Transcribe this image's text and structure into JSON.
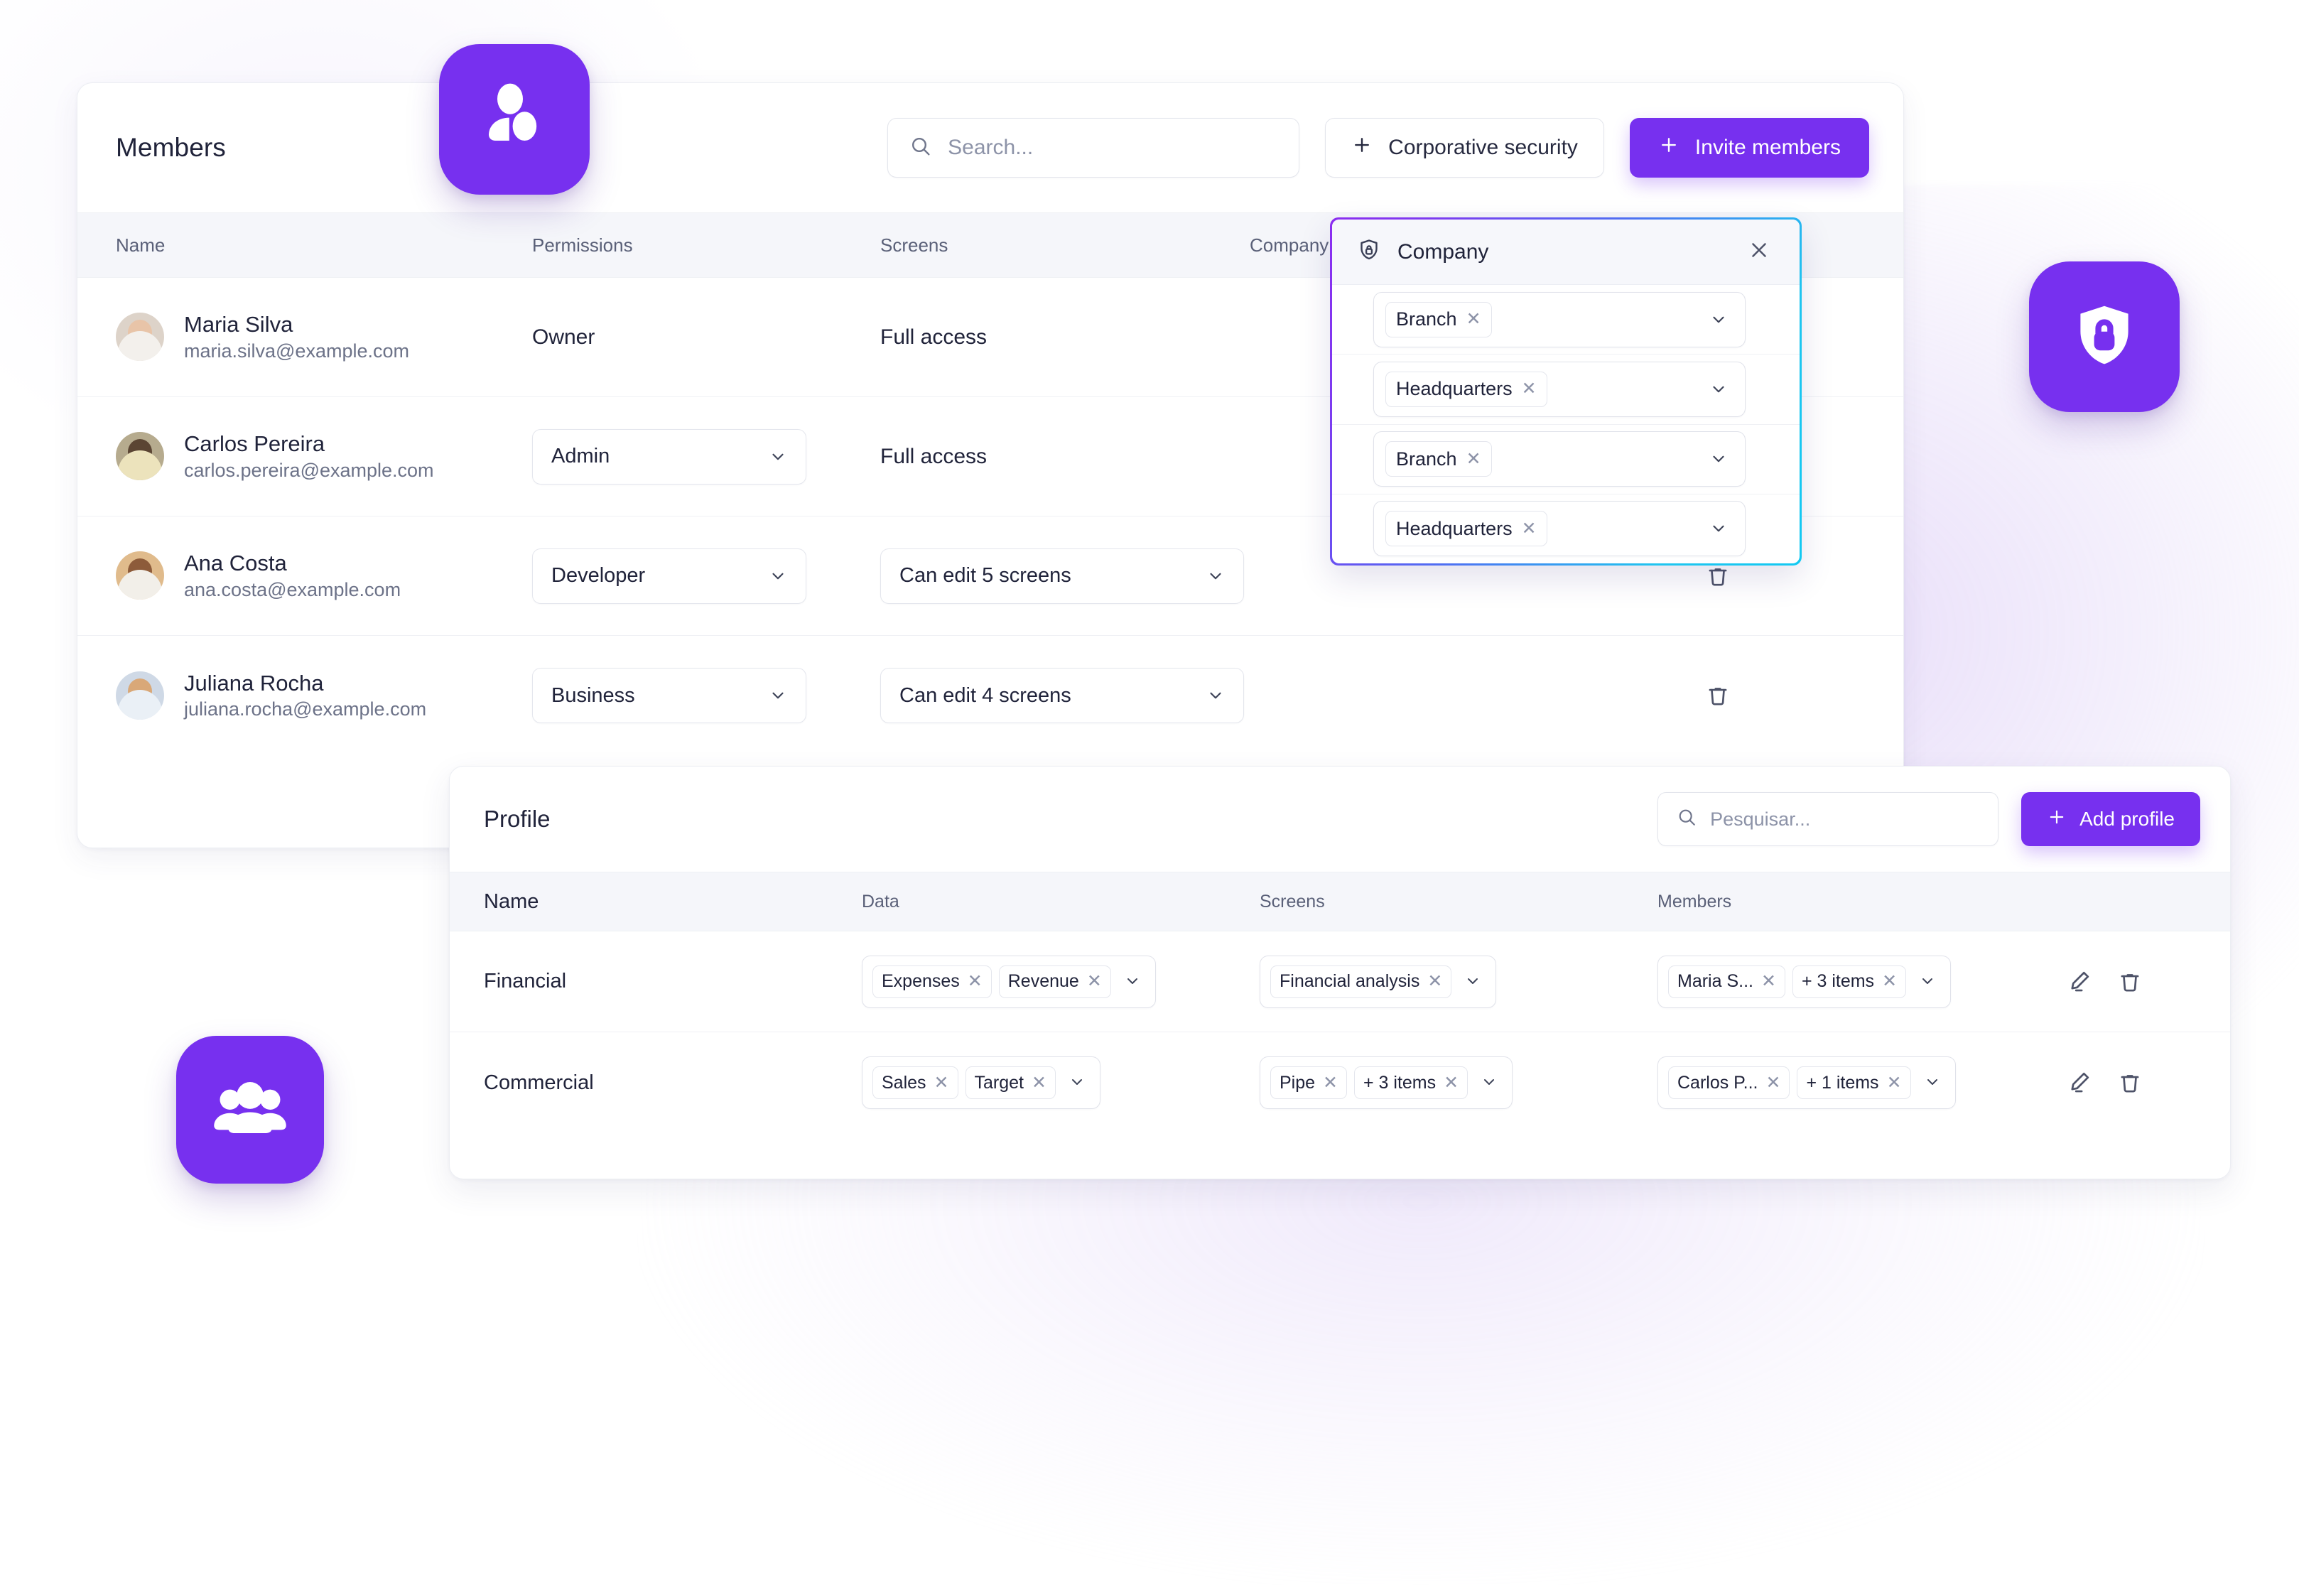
{
  "theme": {
    "accent": "#7730ef",
    "text": "#20233a",
    "muted": "#6c7288",
    "border": "#e4e6ed",
    "head_bg": "#f5f6fa"
  },
  "members_panel": {
    "title": "Members",
    "search": {
      "placeholder": "Search...",
      "value": "",
      "icon": "search-icon"
    },
    "corporative_security_button": "Corporative security",
    "invite_button": "Invite members",
    "columns": [
      "Name",
      "Permissions",
      "Screens",
      "Company",
      ""
    ],
    "rows": [
      {
        "name": "Maria Silva",
        "email": "maria.silva@example.com",
        "permission": "Owner",
        "permission_is_select": false,
        "screens": "Full access",
        "screens_is_select": false,
        "avatar_colors": {
          "bg": "#ddd3c9",
          "skin": "#e8c4a8",
          "cloth": "#f3f0ec"
        },
        "has_delete": false
      },
      {
        "name": "Carlos Pereira",
        "email": "carlos.pereira@example.com",
        "permission": "Admin",
        "permission_is_select": true,
        "screens": "Full access",
        "screens_is_select": false,
        "avatar_colors": {
          "bg": "#b6ab8e",
          "skin": "#5b4533",
          "cloth": "#ece3bc"
        },
        "has_delete": true
      },
      {
        "name": "Ana Costa",
        "email": "ana.costa@example.com",
        "permission": "Developer",
        "permission_is_select": true,
        "screens": "Can edit 5 screens",
        "screens_is_select": true,
        "avatar_colors": {
          "bg": "#e0bb8c",
          "skin": "#8d5b3a",
          "cloth": "#f2efe9"
        },
        "has_delete": true
      },
      {
        "name": "Juliana Rocha",
        "email": "juliana.rocha@example.com",
        "permission": "Business",
        "permission_is_select": true,
        "screens": "Can edit 4 screens",
        "screens_is_select": true,
        "avatar_colors": {
          "bg": "#cfd9e6",
          "skin": "#d9a878",
          "cloth": "#eaf0f6"
        },
        "has_delete": true
      }
    ]
  },
  "company_popup": {
    "title": "Company",
    "icon": "shield-lock-icon",
    "close_icon": "close-icon",
    "rows": [
      {
        "tags": [
          "Branch"
        ]
      },
      {
        "tags": [
          "Headquarters"
        ]
      },
      {
        "tags": [
          "Branch"
        ]
      },
      {
        "tags": [
          "Headquarters"
        ]
      }
    ],
    "border_gradient": [
      "#8b2df0",
      "#4f6ef2",
      "#12c9f2"
    ]
  },
  "profile_panel": {
    "title": "Profile",
    "search": {
      "placeholder": "Pesquisar...",
      "value": "",
      "icon": "search-icon"
    },
    "add_button": "Add profile",
    "columns": [
      "Name",
      "Data",
      "Screens",
      "Members"
    ],
    "rows": [
      {
        "name": "Financial",
        "data_tags": [
          "Expenses",
          "Revenue"
        ],
        "screens_tags": [
          "Financial analysis"
        ],
        "members_tags": [
          "Maria S...",
          "+ 3 items"
        ]
      },
      {
        "name": "Commercial",
        "data_tags": [
          "Sales",
          "Target"
        ],
        "screens_tags": [
          "Pipe",
          "+ 3 items"
        ],
        "members_tags": [
          "Carlos P...",
          "+ 1 items"
        ]
      }
    ],
    "row_actions": {
      "edit_icon": "pencil-icon",
      "delete_icon": "trash-icon"
    }
  },
  "floating_icons": [
    {
      "id": "icon-people-top",
      "name": "people-pair-icon",
      "color": "#7730ef"
    },
    {
      "id": "icon-shield",
      "name": "shield-lock-icon",
      "color": "#7730ef"
    },
    {
      "id": "icon-people-bot",
      "name": "people-group-icon",
      "color": "#7730ef"
    }
  ]
}
